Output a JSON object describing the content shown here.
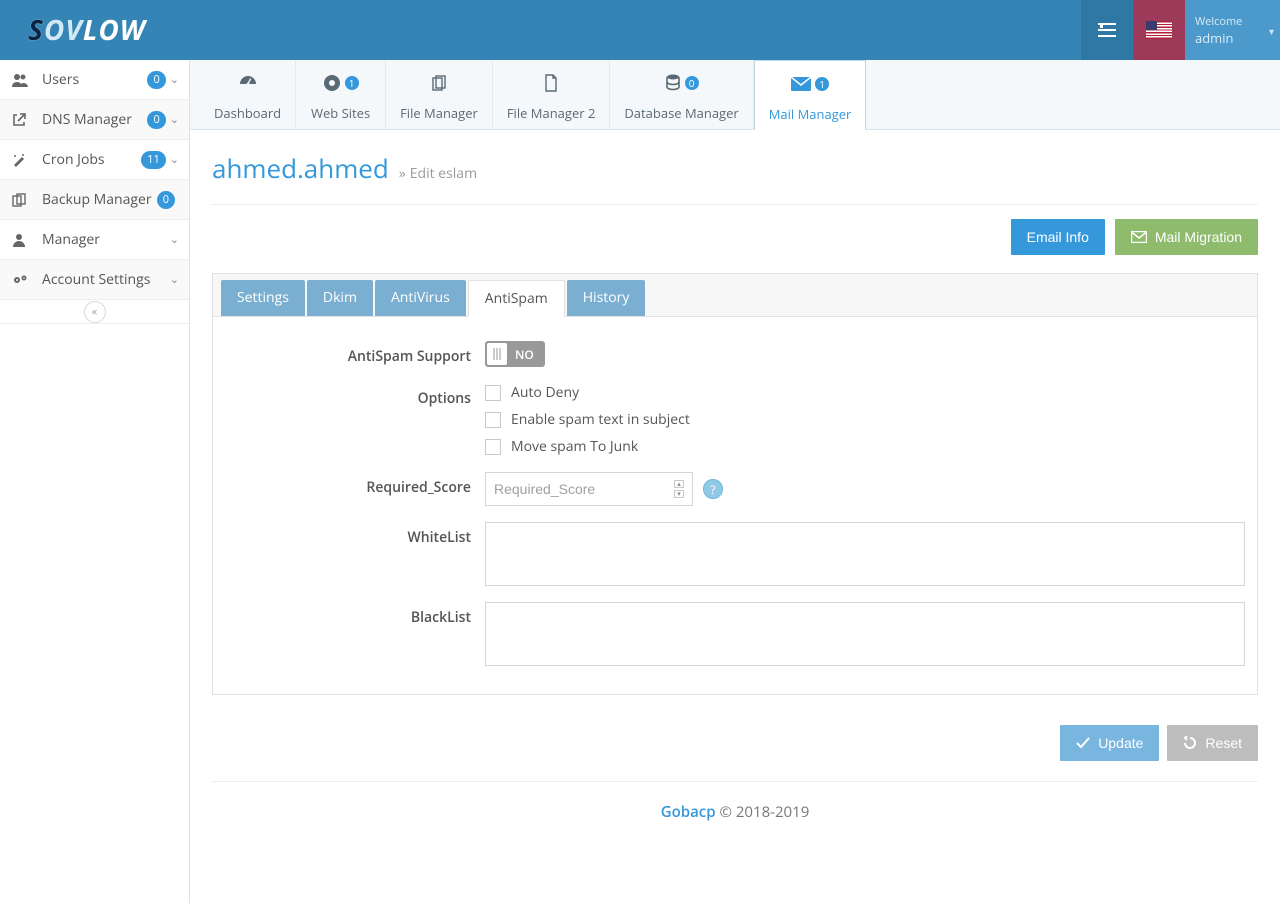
{
  "header": {
    "welcome": "Welcome",
    "username": "admin"
  },
  "sidebar": {
    "items": [
      {
        "label": "Users",
        "badge": "0",
        "has_chevron": true
      },
      {
        "label": "DNS Manager",
        "badge": "0",
        "has_chevron": true
      },
      {
        "label": "Cron Jobs",
        "badge": "11",
        "has_chevron": true
      },
      {
        "label": "Backup Manager",
        "badge": "0",
        "has_chevron": false
      },
      {
        "label": "Manager",
        "badge": null,
        "has_chevron": true
      },
      {
        "label": "Account Settings",
        "badge": null,
        "has_chevron": true
      }
    ]
  },
  "toptabs": [
    {
      "label": "Dashboard",
      "badge": null,
      "active": false
    },
    {
      "label": "Web Sites",
      "badge": "1",
      "active": false
    },
    {
      "label": "File Manager",
      "badge": null,
      "active": false
    },
    {
      "label": "File Manager 2",
      "badge": null,
      "active": false
    },
    {
      "label": "Database Manager",
      "badge": "0",
      "active": false
    },
    {
      "label": "Mail Manager",
      "badge": "1",
      "active": true
    }
  ],
  "page": {
    "title": "ahmed.ahmed",
    "subtitle": "Edit eslam",
    "actions": {
      "email_info": "Email Info",
      "mail_migration": "Mail Migration"
    }
  },
  "panel_tabs": [
    {
      "label": "Settings",
      "active": false
    },
    {
      "label": "Dkim",
      "active": false
    },
    {
      "label": "AntiVirus",
      "active": false
    },
    {
      "label": "AntiSpam",
      "active": true
    },
    {
      "label": "History",
      "active": false
    }
  ],
  "form": {
    "antispam_support": {
      "label": "AntiSpam Support",
      "state_text": "NO"
    },
    "options": {
      "label": "Options",
      "items": [
        {
          "label": "Auto Deny",
          "checked": false
        },
        {
          "label": "Enable spam text in subject",
          "checked": false
        },
        {
          "label": "Move spam To Junk",
          "checked": false
        }
      ]
    },
    "required_score": {
      "label": "Required_Score",
      "placeholder": "Required_Score",
      "value": "",
      "help": "?"
    },
    "whitelist": {
      "label": "WhiteList",
      "value": ""
    },
    "blacklist": {
      "label": "BlackList",
      "value": ""
    }
  },
  "buttons": {
    "update": "Update",
    "reset": "Reset"
  },
  "footer": {
    "brand": "Gobacp",
    "copyright": " © 2018-2019"
  }
}
